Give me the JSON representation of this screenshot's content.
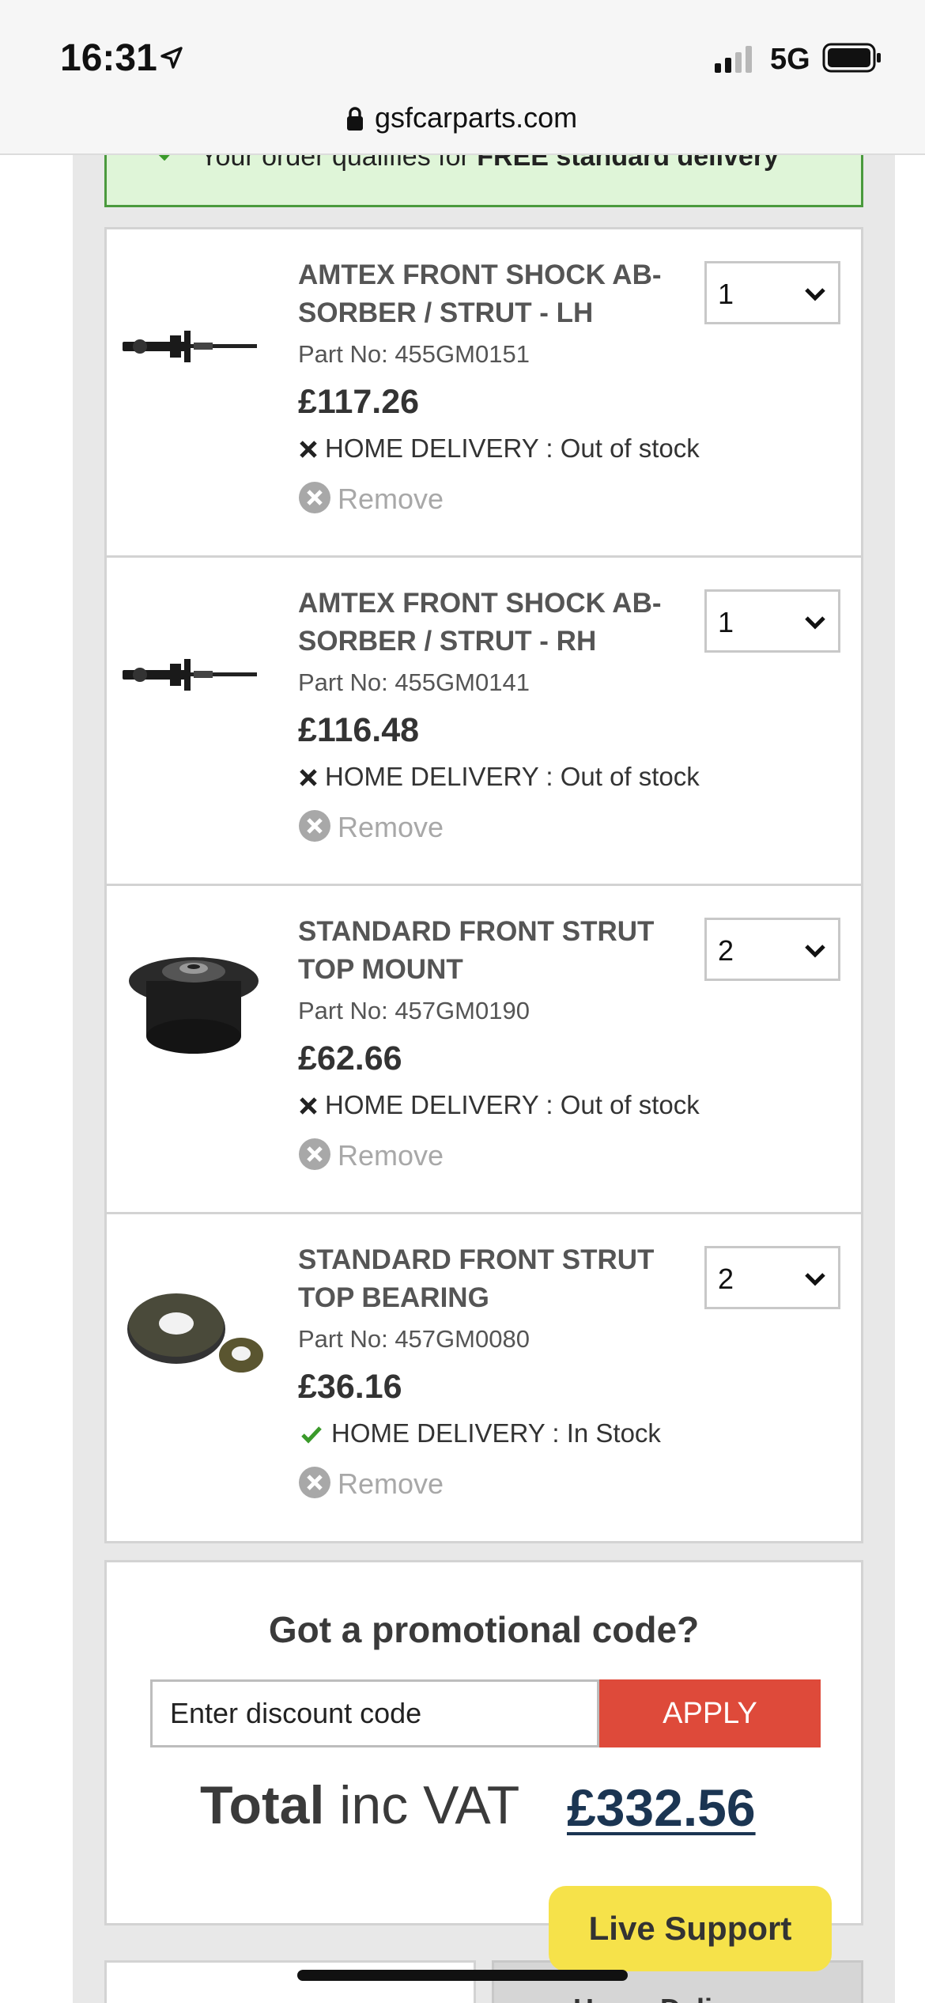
{
  "status_bar": {
    "time": "16:31",
    "network": "5G"
  },
  "browser": {
    "url": "gsfcarparts.com"
  },
  "banner": {
    "text_prefix": "Your order qualifies for ",
    "text_bold": "FREE standard delivery"
  },
  "cart": {
    "items": [
      {
        "title": "AMTEX FRONT SHOCK AB-SORBER / STRUT - LH",
        "title_line1": "AMTEX FRONT SHOCK AB-",
        "title_line2": "SORBER / STRUT - LH",
        "part_no": "Part No: 455GM0151",
        "price": "£117.26",
        "quantity": "1",
        "delivery": "HOME DELIVERY : Out of stock",
        "in_stock": false,
        "remove_label": "Remove",
        "image_icon": "shock-absorber-image"
      },
      {
        "title": "AMTEX FRONT SHOCK AB-SORBER / STRUT - RH",
        "title_line1": "AMTEX FRONT SHOCK AB-",
        "title_line2": "SORBER / STRUT - RH",
        "part_no": "Part No: 455GM0141",
        "price": "£116.48",
        "quantity": "1",
        "delivery": "HOME DELIVERY : Out of stock",
        "in_stock": false,
        "remove_label": "Remove",
        "image_icon": "shock-absorber-image"
      },
      {
        "title": "STANDARD FRONT STRUT TOP MOUNT",
        "title_line1": "STANDARD FRONT STRUT",
        "title_line2": "TOP MOUNT",
        "part_no": "Part No: 457GM0190",
        "price": "£62.66",
        "quantity": "2",
        "delivery": "HOME DELIVERY : Out of stock",
        "in_stock": false,
        "remove_label": "Remove",
        "image_icon": "strut-top-mount-image"
      },
      {
        "title": "STANDARD FRONT STRUT TOP BEARING",
        "title_line1": "STANDARD FRONT STRUT",
        "title_line2": "TOP BEARING",
        "part_no": "Part No: 457GM0080",
        "price": "£36.16",
        "quantity": "2",
        "delivery": "HOME DELIVERY : In Stock",
        "in_stock": true,
        "remove_label": "Remove",
        "image_icon": "strut-top-bearing-image"
      }
    ]
  },
  "promo": {
    "title": "Got a promotional code?",
    "placeholder": "Enter discount code",
    "apply_label": "APPLY",
    "total_label_bold": "Total",
    "total_label_rest": " inc VAT",
    "total_value": "£332.56"
  },
  "bottom": {
    "right_partial_text": "Home Deli"
  },
  "live_support": {
    "label": "Live Support"
  },
  "colors": {
    "banner_bg": "#dff5d8",
    "banner_border": "#4a9a3d",
    "apply_button": "#de4a3a",
    "total_value": "#1b3552",
    "live_support_bg": "#f6e24a",
    "in_stock_check": "#3a9a2a"
  }
}
